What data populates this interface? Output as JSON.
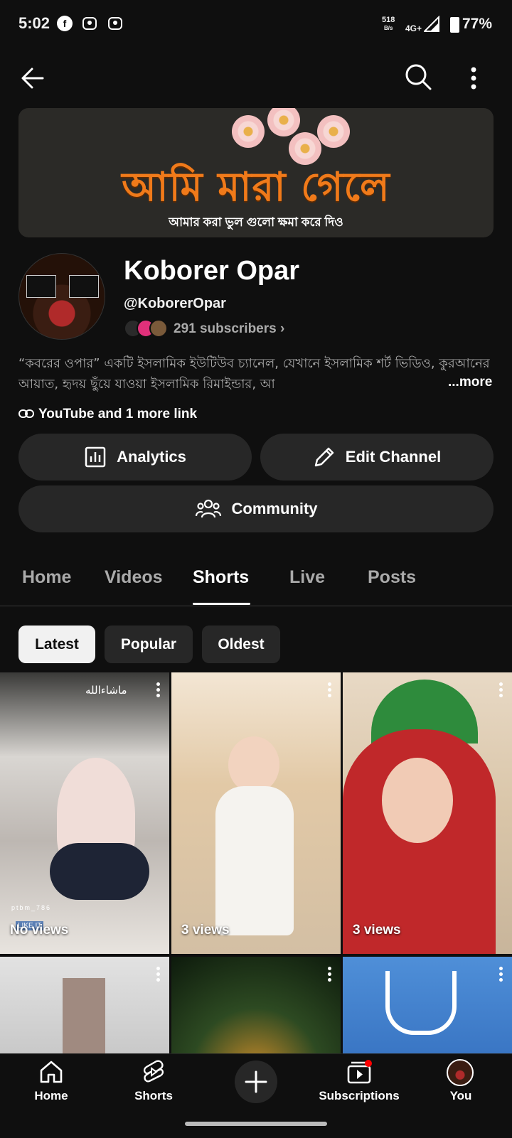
{
  "status_bar": {
    "time": "5:02",
    "net_speed_value": "518",
    "net_speed_unit": "B/s",
    "network": "4G+",
    "battery": "77%"
  },
  "banner": {
    "title": "আমি মারা গেলে",
    "subtitle": "আমার করা ভুল গুলো ক্ষমা করে দিও"
  },
  "channel": {
    "name": "Koborer Opar",
    "handle": "@KoborerOpar",
    "subscribers": "291 subscribers",
    "description": "“কবরের ওপার” একটি ইসলামিক ইউটিউব চ্যানেল, যেখানে ইসলামিক শর্ট ভিডিও, কুরআনের আয়াত, হৃদয় ছুঁয়ে যাওয়া ইসলামিক রিমাইন্ডার, আ",
    "more": "...more",
    "links": "YouTube and 1 more link"
  },
  "actions": {
    "analytics": "Analytics",
    "edit_channel": "Edit Channel",
    "community": "Community"
  },
  "tabs": [
    "Home",
    "Videos",
    "Shorts",
    "Live",
    "Posts"
  ],
  "active_tab": "Shorts",
  "chips": [
    "Latest",
    "Popular",
    "Oldest"
  ],
  "selected_chip": "Latest",
  "shorts": [
    {
      "views": "No views",
      "overlay_text": "ماشاءالله",
      "watermark": "ptbm_786",
      "badge": "LIKE IT"
    },
    {
      "views": "3 views"
    },
    {
      "views": "3 views"
    },
    {
      "views": ""
    },
    {
      "views": ""
    },
    {
      "views": ""
    }
  ],
  "bottom_nav": {
    "home": "Home",
    "shorts": "Shorts",
    "subscriptions": "Subscriptions",
    "you": "You"
  },
  "colors": {
    "background": "#0f0f0f",
    "surface": "#272727",
    "accent_red": "#ff0000",
    "banner_orange": "#f07a1a"
  }
}
